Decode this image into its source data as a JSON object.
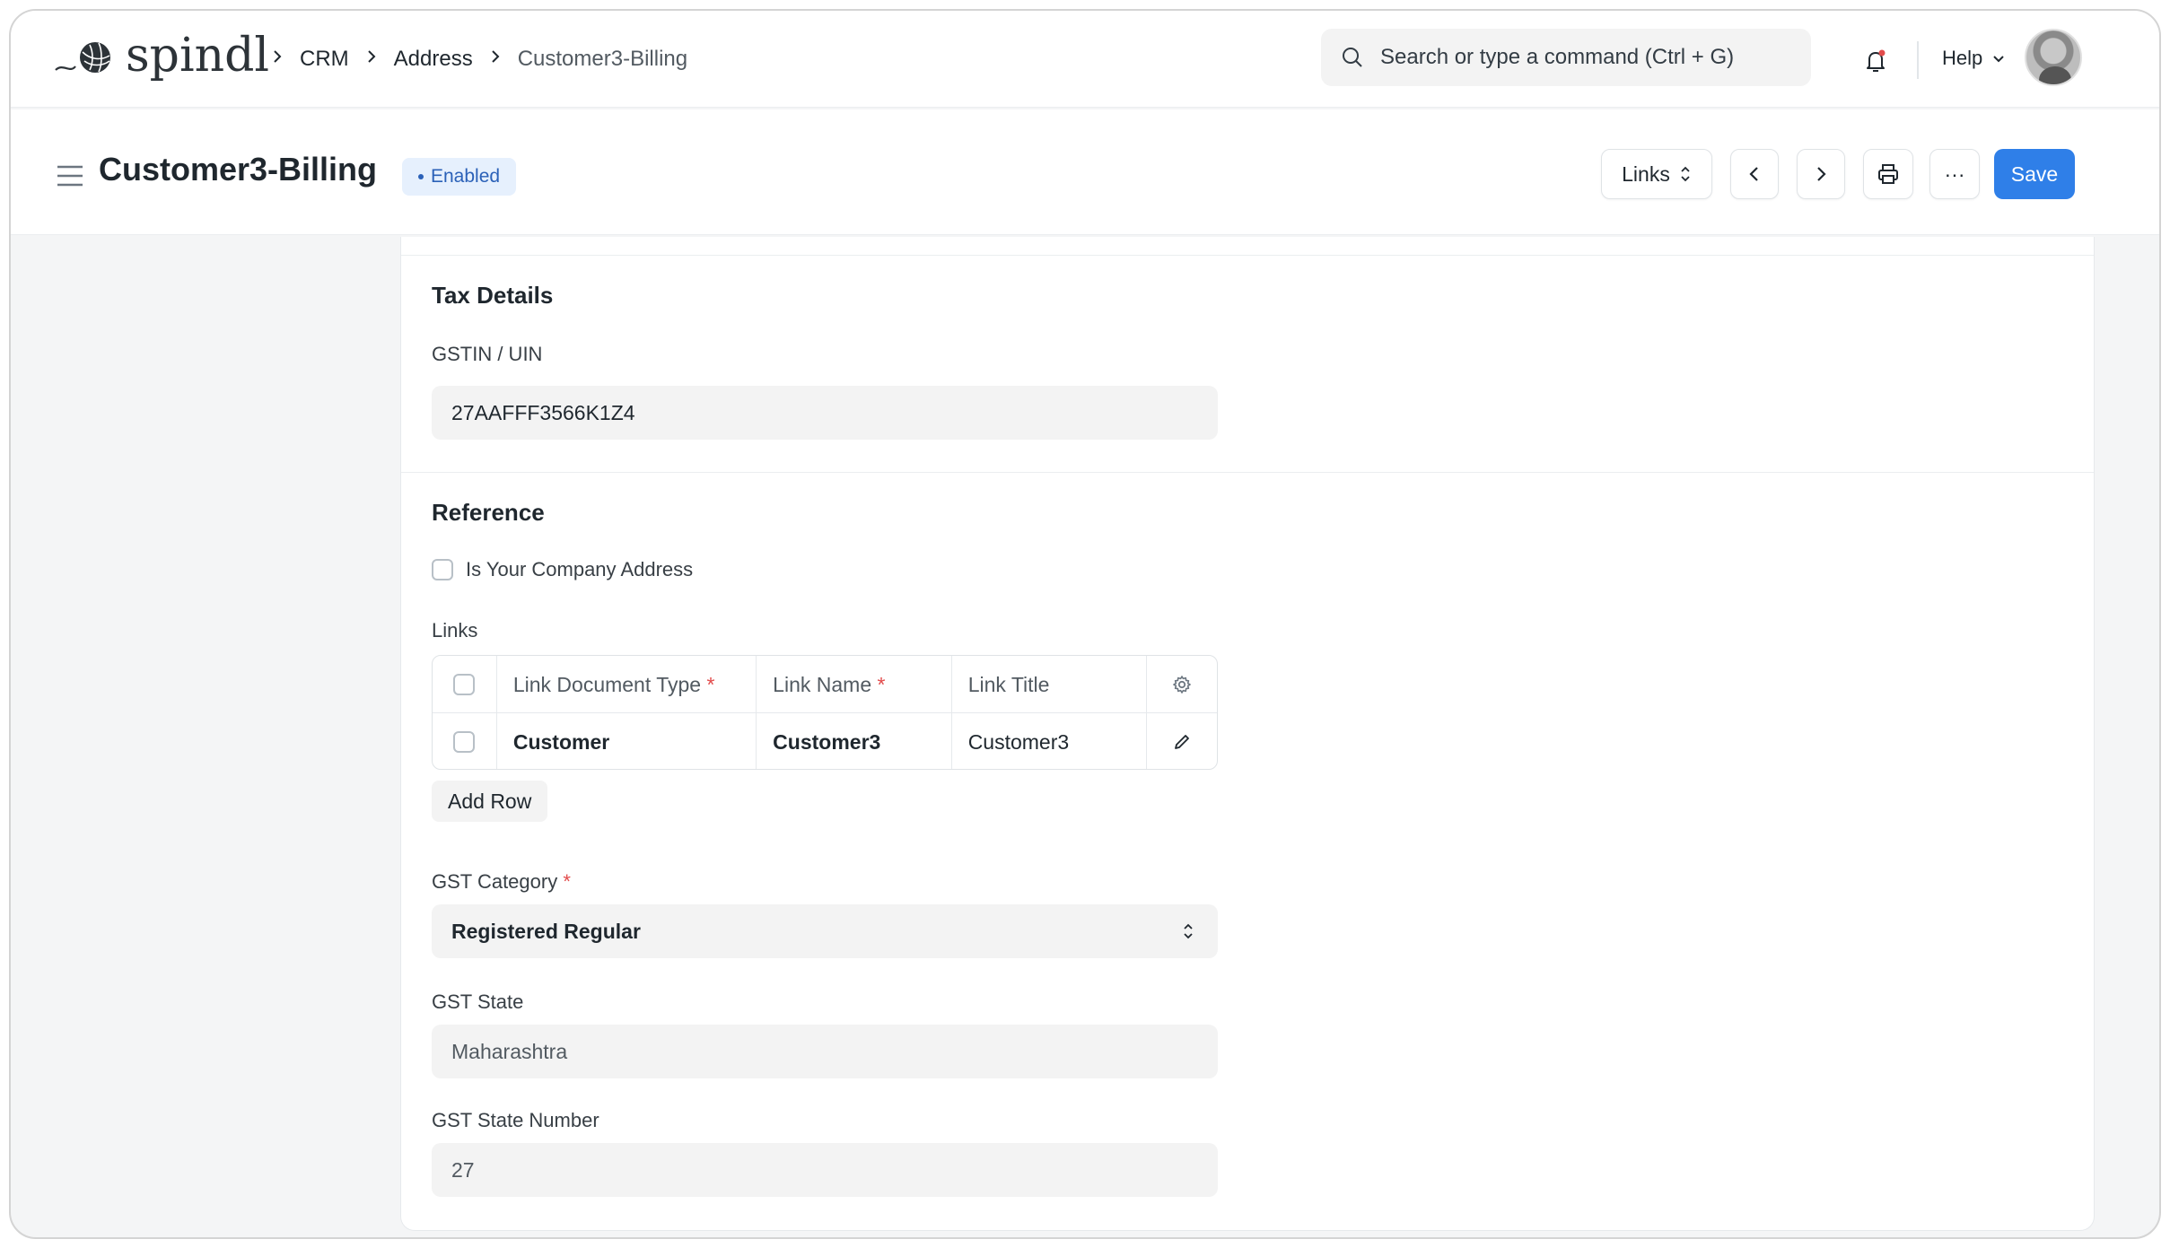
{
  "app": {
    "logo_text": "spindl"
  },
  "breadcrumb": {
    "items": [
      "CRM",
      "Address",
      "Customer3-Billing"
    ]
  },
  "search": {
    "placeholder": "Search or type a command (Ctrl + G)"
  },
  "navbar": {
    "help_label": "Help",
    "icons": [
      "search-icon",
      "bell-icon",
      "chevron-down-icon",
      "avatar"
    ]
  },
  "header": {
    "title": "Customer3-Billing",
    "status": "Enabled",
    "links_label": "Links",
    "save_label": "Save",
    "more_label": "···"
  },
  "tax_details": {
    "section_title": "Tax Details",
    "gstin_label": "GSTIN / UIN",
    "gstin_value": "27AAFFF3566K1Z4"
  },
  "reference": {
    "section_title": "Reference",
    "company_address_label": "Is Your Company Address",
    "links_label": "Links",
    "table": {
      "columns": [
        "Link Document Type",
        "Link Name",
        "Link Title"
      ],
      "rows": [
        {
          "link_document_type": "Customer",
          "link_name": "Customer3",
          "link_title": "Customer3"
        }
      ]
    },
    "add_row_label": "Add Row",
    "gst_category_label": "GST Category",
    "gst_category_value": "Registered Regular",
    "gst_state_label": "GST State",
    "gst_state_value": "Maharashtra",
    "gst_state_number_label": "GST State Number",
    "gst_state_number_value": "27"
  },
  "colors": {
    "primary": "#2f7fe8",
    "badge_bg": "#e6f0fd",
    "badge_text": "#2b61b8",
    "required": "#e24c4c"
  }
}
